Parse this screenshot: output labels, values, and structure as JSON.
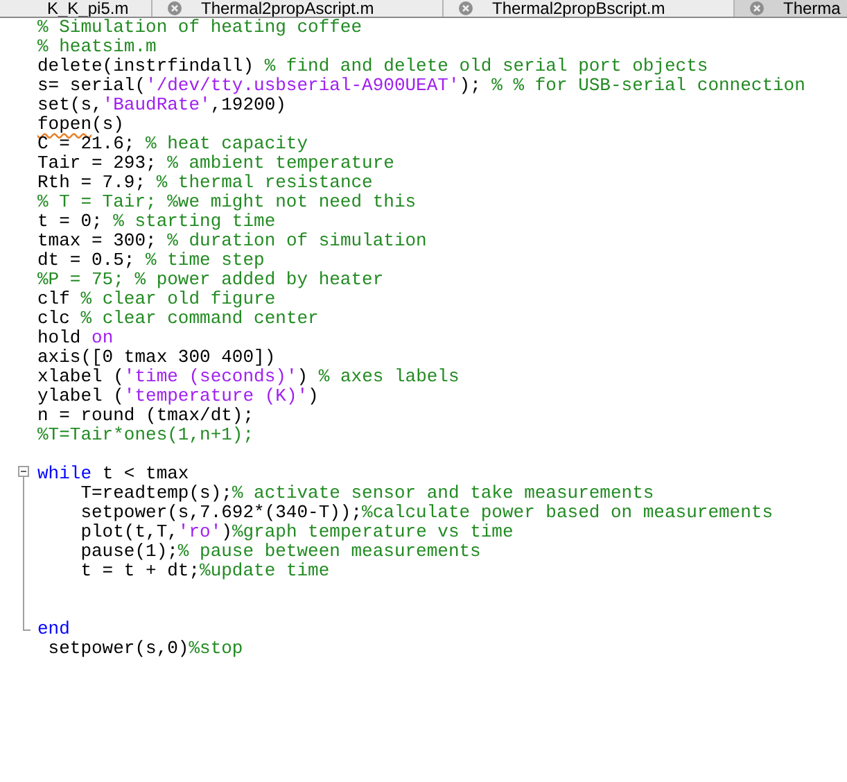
{
  "tabs": [
    {
      "label": "K_K_pi5.m",
      "closable": false,
      "dimmed": false
    },
    {
      "label": "Thermal2propAscript.m",
      "closable": true,
      "dimmed": false
    },
    {
      "label": "Thermal2propBscript.m",
      "closable": true,
      "dimmed": false
    },
    {
      "label": "Therma",
      "closable": true,
      "dimmed": true
    }
  ],
  "lines": [
    {
      "tokens": [
        {
          "kind": "comment",
          "text": "% Simulation of heating coffee"
        }
      ]
    },
    {
      "tokens": [
        {
          "kind": "comment",
          "text": "% heatsim.m"
        }
      ]
    },
    {
      "tokens": [
        {
          "kind": "code",
          "text": "delete(instrfindall) "
        },
        {
          "kind": "comment",
          "text": "% find and delete old serial port objects"
        }
      ]
    },
    {
      "tokens": [
        {
          "kind": "code",
          "text": "s= serial("
        },
        {
          "kind": "string",
          "text": "'/dev/tty.usbserial-A900UEAT'"
        },
        {
          "kind": "code",
          "text": "); "
        },
        {
          "kind": "comment",
          "text": "% % for USB-serial connection"
        }
      ]
    },
    {
      "tokens": [
        {
          "kind": "code",
          "text": "set(s,"
        },
        {
          "kind": "string",
          "text": "'BaudRate'"
        },
        {
          "kind": "code",
          "text": ",19200)"
        }
      ]
    },
    {
      "tokens": [
        {
          "kind": "code",
          "text": "fopen",
          "warning": true
        },
        {
          "kind": "code",
          "text": "(s)"
        }
      ]
    },
    {
      "tokens": [
        {
          "kind": "code",
          "text": "C = 21.6; "
        },
        {
          "kind": "comment",
          "text": "% heat capacity"
        }
      ]
    },
    {
      "tokens": [
        {
          "kind": "code",
          "text": "Tair = 293; "
        },
        {
          "kind": "comment",
          "text": "% ambient temperature"
        }
      ]
    },
    {
      "tokens": [
        {
          "kind": "code",
          "text": "Rth = 7.9; "
        },
        {
          "kind": "comment",
          "text": "% thermal resistance"
        }
      ]
    },
    {
      "tokens": [
        {
          "kind": "comment",
          "text": "% T = Tair; %we might not need this"
        }
      ]
    },
    {
      "tokens": [
        {
          "kind": "code",
          "text": "t = 0; "
        },
        {
          "kind": "comment",
          "text": "% starting time"
        }
      ]
    },
    {
      "tokens": [
        {
          "kind": "code",
          "text": "tmax = 300; "
        },
        {
          "kind": "comment",
          "text": "% duration of simulation"
        }
      ]
    },
    {
      "tokens": [
        {
          "kind": "code",
          "text": "dt = 0.5; "
        },
        {
          "kind": "comment",
          "text": "% time step"
        }
      ]
    },
    {
      "tokens": [
        {
          "kind": "comment",
          "text": "%P = 75; % power added by heater"
        }
      ]
    },
    {
      "tokens": [
        {
          "kind": "code",
          "text": "clf "
        },
        {
          "kind": "comment",
          "text": "% clear old figure"
        }
      ]
    },
    {
      "tokens": [
        {
          "kind": "code",
          "text": "clc "
        },
        {
          "kind": "comment",
          "text": "% clear command center"
        }
      ]
    },
    {
      "tokens": [
        {
          "kind": "code",
          "text": "hold "
        },
        {
          "kind": "string",
          "text": "on"
        }
      ]
    },
    {
      "tokens": [
        {
          "kind": "code",
          "text": "axis([0 tmax 300 400])"
        }
      ]
    },
    {
      "tokens": [
        {
          "kind": "code",
          "text": "xlabel ("
        },
        {
          "kind": "string",
          "text": "'time (seconds)'"
        },
        {
          "kind": "code",
          "text": ") "
        },
        {
          "kind": "comment",
          "text": "% axes labels"
        }
      ]
    },
    {
      "tokens": [
        {
          "kind": "code",
          "text": "ylabel ("
        },
        {
          "kind": "string",
          "text": "'temperature (K)'"
        },
        {
          "kind": "code",
          "text": ")"
        }
      ]
    },
    {
      "tokens": [
        {
          "kind": "code",
          "text": "n = round (tmax/dt);"
        }
      ]
    },
    {
      "tokens": [
        {
          "kind": "comment",
          "text": "%T=Tair*ones(1,n+1);"
        }
      ]
    },
    {
      "blank": true
    },
    {
      "collapse_button": true,
      "tokens": [
        {
          "kind": "keyword",
          "text": "while"
        },
        {
          "kind": "code",
          "text": " t < tmax"
        }
      ]
    },
    {
      "in_block": true,
      "tokens": [
        {
          "kind": "code",
          "text": "    T=readtemp(s);"
        },
        {
          "kind": "comment",
          "text": "% activate sensor and take measurements"
        }
      ]
    },
    {
      "in_block": true,
      "tokens": [
        {
          "kind": "code",
          "text": "    setpower(s,7.692*(340-T));"
        },
        {
          "kind": "comment",
          "text": "%calculate power based on measurements"
        }
      ]
    },
    {
      "in_block": true,
      "tokens": [
        {
          "kind": "code",
          "text": "    plot(t,T,"
        },
        {
          "kind": "string",
          "text": "'ro'"
        },
        {
          "kind": "code",
          "text": ")"
        },
        {
          "kind": "comment",
          "text": "%graph temperature vs time"
        }
      ]
    },
    {
      "in_block": true,
      "tokens": [
        {
          "kind": "code",
          "text": "    pause(1);"
        },
        {
          "kind": "comment",
          "text": "% pause between measurements"
        }
      ]
    },
    {
      "in_block": true,
      "tokens": [
        {
          "kind": "code",
          "text": "    t = t + dt;"
        },
        {
          "kind": "comment",
          "text": "%update time"
        }
      ]
    },
    {
      "blank": true,
      "in_block": true
    },
    {
      "blank": true,
      "in_block": true
    },
    {
      "block_end": true,
      "tokens": [
        {
          "kind": "keyword",
          "text": "end"
        }
      ]
    },
    {
      "tokens": [
        {
          "kind": "code",
          "text": " setpower(s,0)"
        },
        {
          "kind": "comment",
          "text": "%stop"
        }
      ]
    }
  ]
}
